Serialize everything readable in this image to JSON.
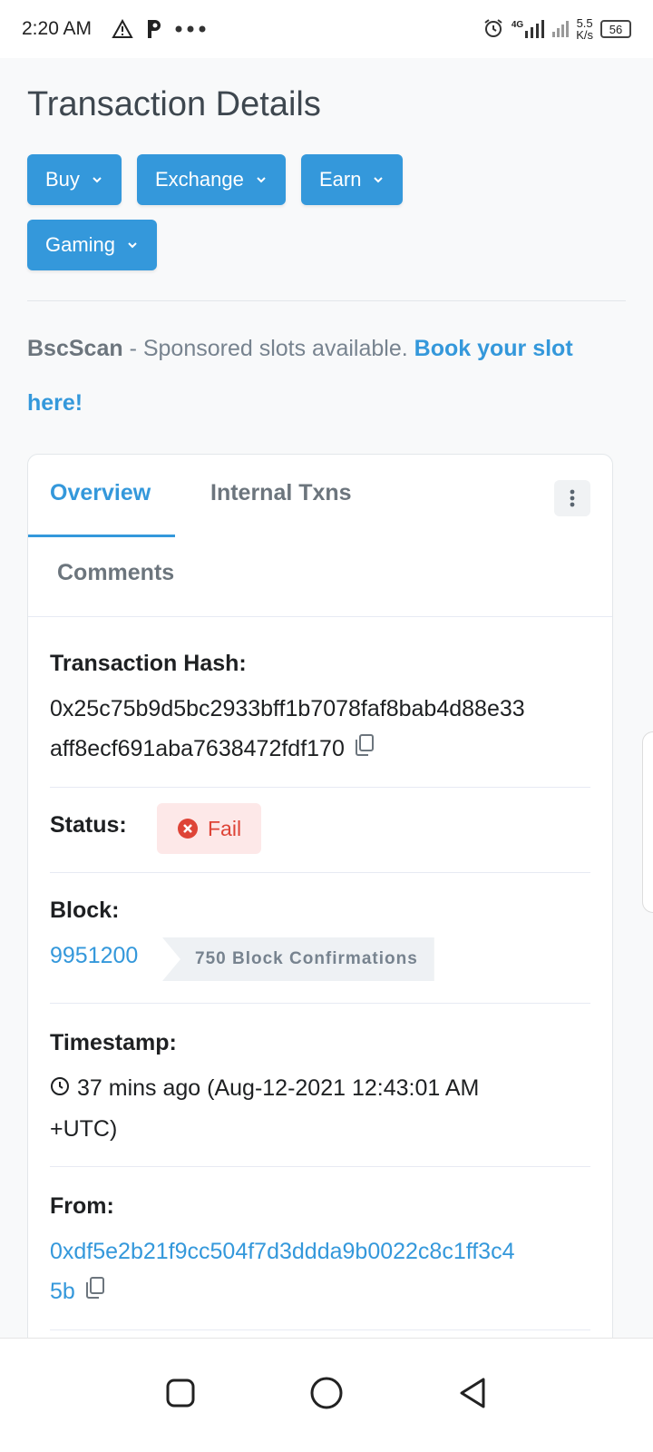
{
  "status_bar": {
    "time": "2:20 AM",
    "network": "4G",
    "speed_value": "5.5",
    "speed_unit": "K/s",
    "battery": "56"
  },
  "page": {
    "title": "Transaction Details",
    "menu": [
      {
        "label": "Buy"
      },
      {
        "label": "Exchange"
      },
      {
        "label": "Earn"
      },
      {
        "label": "Gaming"
      }
    ],
    "sponsor": {
      "brand": "BscScan",
      "text": " - Sponsored slots available. ",
      "link": "Book your slot here!"
    }
  },
  "card": {
    "tabs": {
      "overview": "Overview",
      "internal": "Internal Txns",
      "comments": "Comments"
    },
    "tx_hash": {
      "label": "Transaction Hash:",
      "line1": "0x25c75b9d5bc2933bff1b7078faf8bab4d88e33",
      "line2": "aff8ecf691aba7638472fdf170"
    },
    "status": {
      "label": "Status:",
      "value": "Fail"
    },
    "block": {
      "label": "Block:",
      "number": "9951200",
      "confirmations": "750 Block Confirmations"
    },
    "timestamp": {
      "label": "Timestamp:",
      "line1": "37 mins ago (Aug-12-2021 12:43:01 AM",
      "line2": "+UTC)"
    },
    "from": {
      "label": "From:",
      "line1": "0xdf5e2b21f9cc504f7d3ddda9b0022c8c1ff3c4",
      "line2": "5b"
    }
  },
  "colors": {
    "accent": "#3498db",
    "fail": "#de4437",
    "fail_bg": "#fde8e8"
  }
}
